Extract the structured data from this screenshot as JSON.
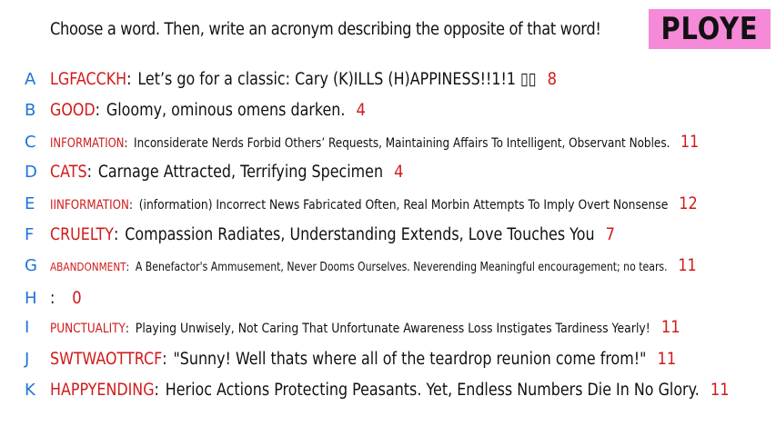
{
  "prompt": "Choose a word. Then, write an acronym describing the opposite of that word!",
  "player_badge": "PLOYE",
  "colors": {
    "letter": "#1e73d8",
    "word": "#d11a1a",
    "badge": "#f58ad8"
  },
  "entries": [
    {
      "letter": "A",
      "word": "LGFACCKH",
      "text": "Let’s go for a classic: Cary (K)ILLS (H)APPINESS!!1!1 ▯▯",
      "score": "8"
    },
    {
      "letter": "B",
      "word": "GOOD",
      "text": "Gloomy, ominous omens darken.",
      "score": "4"
    },
    {
      "letter": "C",
      "word": "INFORMATION",
      "text": "Inconsiderate Nerds Forbid Others’ Requests, Maintaining Affairs To Intelligent, Observant Nobles.",
      "score": "11"
    },
    {
      "letter": "D",
      "word": "CATS",
      "text": "Carnage Attracted, Terrifying Specimen",
      "score": "4"
    },
    {
      "letter": "E",
      "word": "IINFORMATION",
      "text": "(information) Incorrect News Fabricated Often, Real Morbin Attempts To Imply Overt Nonsense",
      "score": "12"
    },
    {
      "letter": "F",
      "word": "CRUELTY",
      "text": "Compassion Radiates, Understanding Extends, Love Touches You",
      "score": "7"
    },
    {
      "letter": "G",
      "word": "ABANDONMENT",
      "text": "A Benefactor's Ammusement, Never Dooms Ourselves. Neverending Meaningful encouragement; no tears.",
      "score": "11"
    },
    {
      "letter": "H",
      "word": "",
      "text": "",
      "score": "0"
    },
    {
      "letter": "I",
      "word": "PUNCTUALITY",
      "text": "Playing Unwisely, Not Caring That Unfortunate Awareness Loss Instigates Tardiness Yearly!",
      "score": "11"
    },
    {
      "letter": "J",
      "word": "SWTWAOTTRCF",
      "text": "\"Sunny! Well thats where all of the teardrop reunion come from!\"",
      "score": "11"
    },
    {
      "letter": "K",
      "word": "HAPPYENDING",
      "text": "Herioc Actions Protecting Peasants. Yet, Endless Numbers Die In No Glory.",
      "score": "11"
    }
  ]
}
